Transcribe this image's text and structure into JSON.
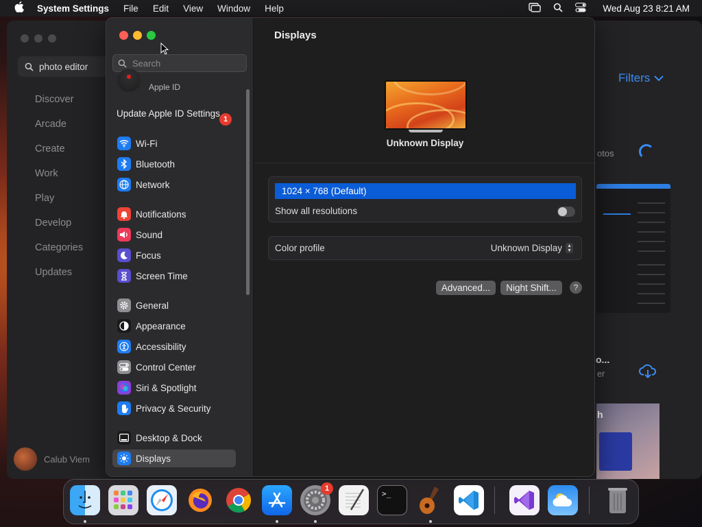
{
  "menubar": {
    "app": "System Settings",
    "items": [
      "File",
      "Edit",
      "View",
      "Window",
      "Help"
    ],
    "clock": "Wed Aug 23  8:21 AM"
  },
  "background_app": {
    "search_value": "photo editor",
    "nav": [
      "Discover",
      "Arcade",
      "Create",
      "Work",
      "Play",
      "Develop",
      "Categories",
      "Updates"
    ],
    "user": "Calub Viem",
    "filters": "Filters",
    "partial_text_1": "otos",
    "partial_text_2": "o...",
    "partial_text_3": "er",
    "partial_text_4": "h"
  },
  "sidebar": {
    "search_placeholder": "Search",
    "apple_id": "Apple ID",
    "update_label": "Update Apple ID Settings",
    "update_badge": "1",
    "items": [
      {
        "label": "Wi-Fi",
        "icon": "wifi-icon",
        "color": "#1e7cf2"
      },
      {
        "label": "Bluetooth",
        "icon": "bluetooth-icon",
        "color": "#1e7cf2"
      },
      {
        "label": "Network",
        "icon": "globe-icon",
        "color": "#1e7cf2"
      },
      {
        "label": "Notifications",
        "icon": "bell-icon",
        "color": "#ee4437"
      },
      {
        "label": "Sound",
        "icon": "speaker-icon",
        "color": "#ee3a5a"
      },
      {
        "label": "Focus",
        "icon": "moon-icon",
        "color": "#5a4fcf"
      },
      {
        "label": "Screen Time",
        "icon": "hourglass-icon",
        "color": "#5a4fcf"
      },
      {
        "label": "General",
        "icon": "gear-icon",
        "color": "#8e8e93"
      },
      {
        "label": "Appearance",
        "icon": "appearance-icon",
        "color": "#1a1a1a"
      },
      {
        "label": "Accessibility",
        "icon": "accessibility-icon",
        "color": "#1e7cf2"
      },
      {
        "label": "Control Center",
        "icon": "switches-icon",
        "color": "#8e8e93"
      },
      {
        "label": "Siri & Spotlight",
        "icon": "siri-icon",
        "color": "#8a3fd8"
      },
      {
        "label": "Privacy & Security",
        "icon": "hand-icon",
        "color": "#1e7cf2"
      },
      {
        "label": "Desktop & Dock",
        "icon": "dock-icon",
        "color": "#1a1a1a"
      },
      {
        "label": "Displays",
        "icon": "sun-icon",
        "color": "#1e7cf2"
      }
    ]
  },
  "content": {
    "title": "Displays",
    "display_name": "Unknown Display",
    "resolution": "1024 × 768 (Default)",
    "show_all_label": "Show all resolutions",
    "show_all_on": false,
    "color_profile_label": "Color profile",
    "color_profile_value": "Unknown Display",
    "advanced_button": "Advanced...",
    "night_shift_button": "Night Shift...",
    "help_button": "?"
  },
  "dock": {
    "apps": [
      "finder-icon",
      "launchpad-icon",
      "safari-icon",
      "firefox-icon",
      "chrome-icon",
      "app-store-icon",
      "system-settings-icon",
      "textedit-icon",
      "terminal-icon",
      "garageband-icon",
      "vscode-icon",
      "visual-studio-icon",
      "weather-icon",
      "trash-icon"
    ],
    "settings_badge": "1",
    "terminal_glyph": ">_"
  }
}
